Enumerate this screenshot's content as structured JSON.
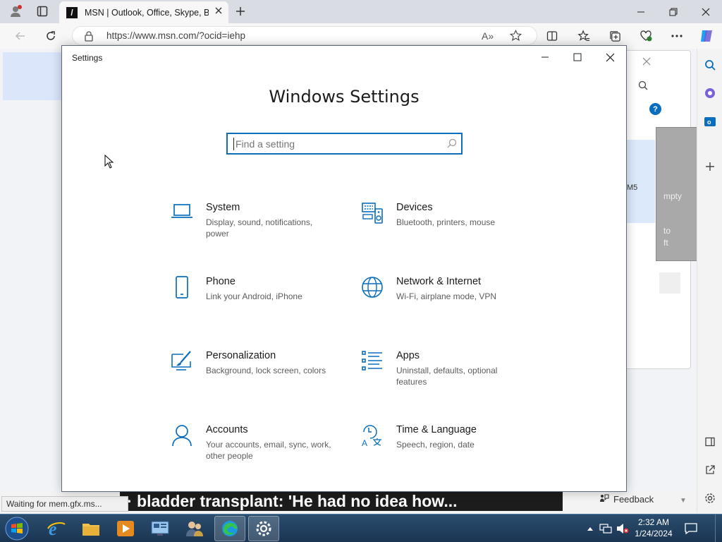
{
  "browser": {
    "tab_title": "MSN | Outlook, Office, Skype, Bing",
    "url": "https://www.msn.com/?ocid=iehp",
    "status_text": "Waiting for mem.gfx.ms...",
    "ticker_text": "· bladder transplant: 'He had no idea how...",
    "feedback_label": "Feedback",
    "partial_texts": [
      "M5",
      "mpty",
      "to",
      "ft"
    ]
  },
  "settings": {
    "window_title": "Settings",
    "heading": "Windows Settings",
    "search_placeholder": "Find a setting",
    "categories": [
      {
        "name": "System",
        "desc": "Display, sound, notifications, power",
        "icon": "laptop-icon"
      },
      {
        "name": "Devices",
        "desc": "Bluetooth, printers, mouse",
        "icon": "keyboard-speaker-icon"
      },
      {
        "name": "Phone",
        "desc": "Link your Android, iPhone",
        "icon": "phone-icon"
      },
      {
        "name": "Network & Internet",
        "desc": "Wi-Fi, airplane mode, VPN",
        "icon": "globe-icon"
      },
      {
        "name": "Personalization",
        "desc": "Background, lock screen, colors",
        "icon": "paint-brush-icon"
      },
      {
        "name": "Apps",
        "desc": "Uninstall, defaults, optional features",
        "icon": "apps-list-icon"
      },
      {
        "name": "Accounts",
        "desc": "Your accounts, email, sync, work, other people",
        "icon": "person-icon"
      },
      {
        "name": "Time & Language",
        "desc": "Speech, region, date",
        "icon": "time-language-icon"
      }
    ]
  },
  "taskbar": {
    "time": "2:32 AM",
    "date": "1/24/2024"
  },
  "colors": {
    "accent": "#0a6ebd",
    "taskbar": "#1f3d5c"
  }
}
